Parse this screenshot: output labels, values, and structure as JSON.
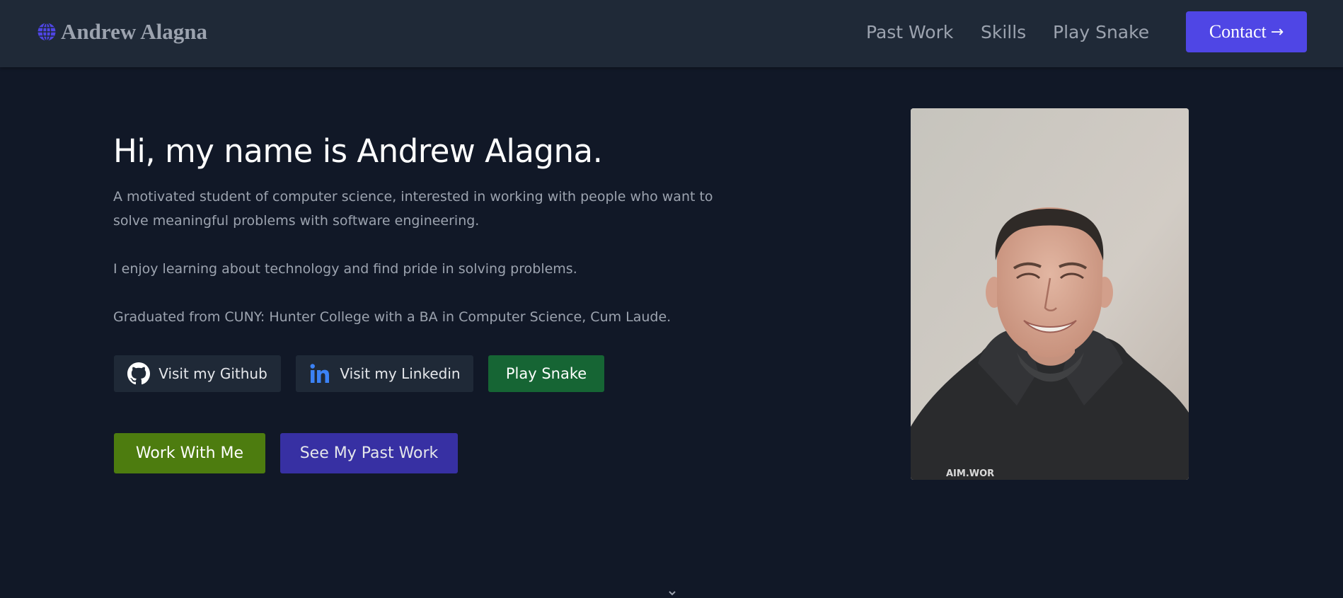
{
  "header": {
    "brand_name": "Andrew Alagna",
    "brand_icon": "globe-icon",
    "nav": {
      "past_work": "Past Work",
      "skills": "Skills",
      "play_snake": "Play Snake"
    },
    "contact_label": "Contact",
    "contact_arrow": "→"
  },
  "hero": {
    "title": "Hi, my name is Andrew Alagna.",
    "intro": "A motivated student of computer science, interested in working with people who want to solve meaningful problems with software engineering.",
    "enjoy": "I enjoy learning about technology and find pride in solving problems.",
    "graduated": "Graduated from CUNY: Hunter College with a BA in Computer Science, Cum Laude.",
    "buttons": {
      "github": "Visit my Github",
      "linkedin": "Visit my Linkedin",
      "snake": "Play Snake",
      "work_with_me": "Work With Me",
      "past_work": "See My Past Work"
    }
  },
  "colors": {
    "page_bg": "#111827",
    "nav_bg": "#1f2937",
    "accent": "#4f46e5",
    "snake_green": "#166534",
    "work_green": "#4d7c0f",
    "past_indigo": "#3730a3",
    "linkedin_blue": "#3b82f6"
  }
}
